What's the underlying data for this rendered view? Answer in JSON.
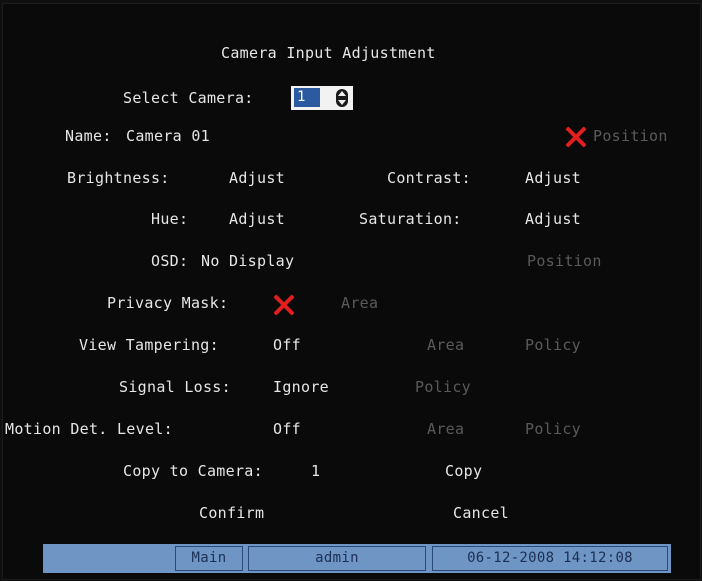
{
  "title": "Camera Input Adjustment",
  "select_camera": {
    "label": "Select Camera:",
    "value": "1"
  },
  "name": {
    "label": "Name:",
    "value": "Camera 01",
    "position": "Position"
  },
  "brightness": {
    "label": "Brightness:",
    "action": "Adjust"
  },
  "contrast": {
    "label": "Contrast:",
    "action": "Adjust"
  },
  "hue": {
    "label": "Hue:",
    "action": "Adjust"
  },
  "saturation": {
    "label": "Saturation:",
    "action": "Adjust"
  },
  "osd": {
    "label": "OSD:",
    "value": "No Display",
    "position": "Position"
  },
  "privacy_mask": {
    "label": "Privacy Mask:",
    "area": "Area"
  },
  "view_tampering": {
    "label": "View Tampering:",
    "value": "Off",
    "area": "Area",
    "policy": "Policy"
  },
  "signal_loss": {
    "label": "Signal Loss:",
    "value": "Ignore",
    "policy": "Policy"
  },
  "motion": {
    "label": "Motion Det. Level:",
    "value": "Off",
    "area": "Area",
    "policy": "Policy"
  },
  "copy_to": {
    "label": "Copy to Camera:",
    "value": "1",
    "button": "Copy"
  },
  "buttons": {
    "confirm": "Confirm",
    "cancel": "Cancel"
  },
  "status_bar": {
    "menu": "Main",
    "user": "admin",
    "datetime": "06-12-2008 14:12:08"
  },
  "colors": {
    "background": "#0a0a0a",
    "text": "#e6e6e6",
    "disabled": "#5a5a5a",
    "disabled_mark": "#e21e1e",
    "status_bar": "#6f95c4",
    "selection": "#2c5aa0"
  },
  "icons": {
    "disabled_mark": "red-x-icon",
    "spinner": "up-down-arrow-icon"
  }
}
